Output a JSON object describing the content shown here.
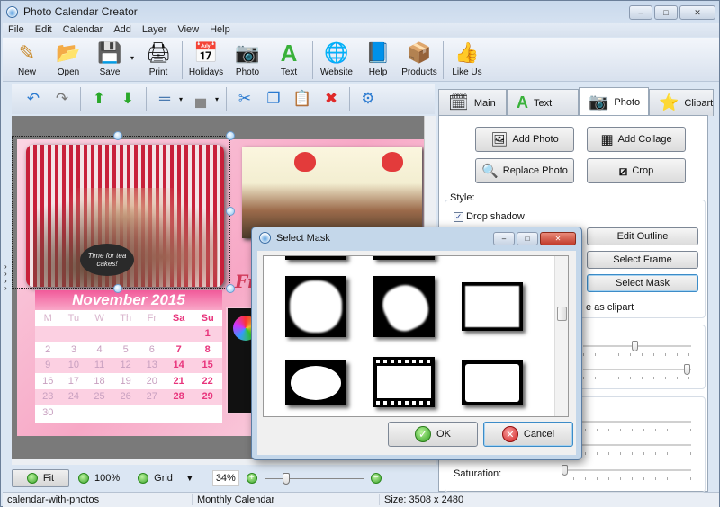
{
  "window": {
    "title": "Photo Calendar Creator",
    "controls": {
      "minimize": "–",
      "maximize": "□",
      "close": "✕"
    }
  },
  "menu": [
    "File",
    "Edit",
    "Calendar",
    "Add",
    "Layer",
    "View",
    "Help"
  ],
  "toolbar": [
    {
      "label": "New",
      "icon": "new-document-icon",
      "glyph": "✎"
    },
    {
      "label": "Open",
      "icon": "folder-open-icon",
      "glyph": "📂"
    },
    {
      "label": "Save",
      "icon": "floppy-disk-icon",
      "glyph": "💾"
    },
    {
      "label": "Print",
      "icon": "printer-icon",
      "glyph": "🖨"
    },
    {
      "label": "Holidays",
      "icon": "calendar-icon",
      "glyph": "📅"
    },
    {
      "label": "Photo",
      "icon": "camera-icon",
      "glyph": "📷"
    },
    {
      "label": "Text",
      "icon": "text-a-icon",
      "glyph": "A"
    },
    {
      "label": "Website",
      "icon": "globe-arrow-icon",
      "glyph": "🌐"
    },
    {
      "label": "Help",
      "icon": "book-icon",
      "glyph": "📘"
    },
    {
      "label": "Products",
      "icon": "box-icon",
      "glyph": "📦"
    },
    {
      "label": "Like Us",
      "icon": "thumbs-up-icon",
      "glyph": "👍"
    }
  ],
  "edit_toolbar": {
    "undo": "↶",
    "redo": "↷",
    "bring_forward": "⬆",
    "send_backward": "⬇",
    "align": "═",
    "arrange": "▄",
    "cut": "✂",
    "copy": "❐",
    "paste": "📋",
    "delete": "✖",
    "properties": "⚙",
    "dropdown": "▾"
  },
  "canvas": {
    "photo_caption": "Time for tea cakes!",
    "side_text": "Fri",
    "calendar": {
      "month_title": "November 2015",
      "weekdays": [
        "M",
        "Tu",
        "W",
        "Th",
        "Fr",
        "Sa",
        "Su"
      ],
      "weeks": [
        [
          "",
          "",
          "",
          "",
          "",
          "",
          "1"
        ],
        [
          "2",
          "3",
          "4",
          "5",
          "6",
          "7",
          "8"
        ],
        [
          "9",
          "10",
          "11",
          "12",
          "13",
          "14",
          "15"
        ],
        [
          "16",
          "17",
          "18",
          "19",
          "20",
          "21",
          "22"
        ],
        [
          "23",
          "24",
          "25",
          "26",
          "27",
          "28",
          "29"
        ],
        [
          "30",
          "",
          "",
          "",
          "",
          "",
          ""
        ]
      ]
    },
    "expand_arrows": "›\n›\n›\n›"
  },
  "bottom_bar": {
    "fit": "Fit",
    "zoom100": "100%",
    "grid": "Grid",
    "grid_dropdown": "▼",
    "zoom_value": "34%",
    "zoom_in": "+",
    "zoom_out": "−",
    "zoom_slider_fraction": 0.2
  },
  "status": {
    "file": "calendar-with-photos",
    "type": "Monthly Calendar",
    "size": "Size: 3508 x 2480"
  },
  "right_panel": {
    "tabs": [
      {
        "label": "Main",
        "icon": "calendar-sheet-icon",
        "glyph": "🗓"
      },
      {
        "label": "Text",
        "icon": "text-a-icon",
        "glyph": "A"
      },
      {
        "label": "Photo",
        "icon": "camera-icon",
        "glyph": "📷",
        "active": true
      },
      {
        "label": "Clipart",
        "icon": "star-icon",
        "glyph": "⭐"
      }
    ],
    "buttons": {
      "add_photo": "Add Photo",
      "add_collage": "Add Collage",
      "replace_photo": "Replace Photo",
      "crop": "Crop"
    },
    "style": {
      "label": "Style:",
      "drop_shadow": "Drop shadow",
      "drop_shadow_checked": true,
      "edit_outline": "Edit Outline",
      "select_frame": "Select Frame",
      "select_mask": "Select Mask",
      "save_as_clipart_partial": "e as clipart"
    },
    "sliders": [
      {
        "fraction": 0.48
      },
      {
        "fraction": 1.0
      },
      {
        "fraction": 0.0
      },
      {
        "fraction": 0.0
      }
    ],
    "saturation_label": "Saturation:",
    "saturation_fraction": 0.0
  },
  "dialog": {
    "title": "Select Mask",
    "ok": "OK",
    "cancel": "Cancel",
    "masks": [
      "torn-circle-mask",
      "brush-stroke-mask",
      "rough-rectangle-mask",
      "ornate-oval-mask",
      "film-strip-mask",
      "rounded-rectangle-mask"
    ],
    "scroll_fraction": 0.35
  }
}
